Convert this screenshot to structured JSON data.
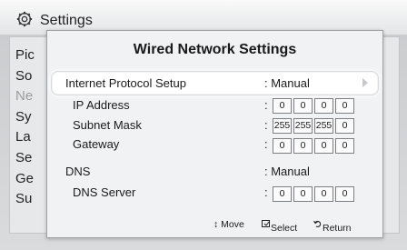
{
  "background": {
    "title": "Settings",
    "menu_items": [
      "Pic",
      "So",
      "Ne",
      "Sy",
      "La",
      "Se",
      "Ge",
      "Su"
    ]
  },
  "dialog": {
    "title": "Wired Network Settings",
    "rows": {
      "internet_protocol": {
        "label": "Internet Protocol Setup",
        "value": ": Manual"
      },
      "ip_address": {
        "label": "IP Address",
        "values": [
          "0",
          "0",
          "0",
          "0"
        ]
      },
      "subnet_mask": {
        "label": "Subnet Mask",
        "values": [
          "255",
          "255",
          "255",
          "0"
        ]
      },
      "gateway": {
        "label": "Gateway",
        "values": [
          "0",
          "0",
          "0",
          "0"
        ]
      },
      "dns": {
        "label": "DNS",
        "value": ": Manual"
      },
      "dns_server": {
        "label": "DNS Server",
        "values": [
          "0",
          "0",
          "0",
          "0"
        ]
      }
    },
    "footer": {
      "move": "↕ Move",
      "select": "Select",
      "return": "Return"
    }
  },
  "colors": {
    "dialog_bg": "#f1f2f3",
    "highlight": "#ffffff",
    "box_border": "#7d7f83"
  }
}
